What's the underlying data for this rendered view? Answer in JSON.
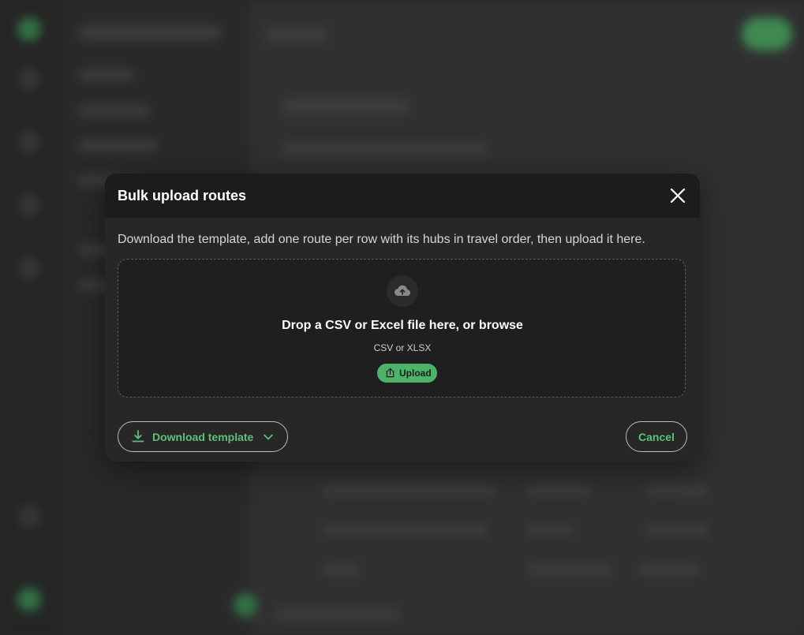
{
  "dialog": {
    "title": "Bulk upload routes",
    "instructions": "Download the template, add one route per row with its hubs in travel order, then upload it here.",
    "dropzone": {
      "title": "Drop a CSV or Excel file here, or browse",
      "formats": "CSV or XLSX",
      "upload_label": "Upload",
      "icon": "cloud-upload-icon"
    },
    "download_template_label": "Download template",
    "cancel_label": "Cancel"
  },
  "colors": {
    "accent": "#5cc27a",
    "upload_button": "#4cb369",
    "dialog_bg": "#272727",
    "header_bg": "#1c1c1c"
  }
}
